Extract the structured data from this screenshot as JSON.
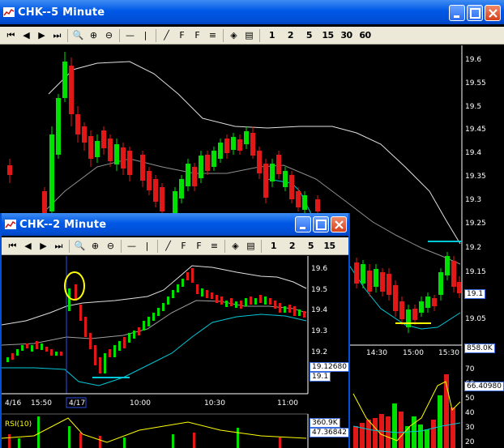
{
  "main_window": {
    "title": "CHK--5 Minute",
    "toolbar": {
      "interval_labels": [
        "1",
        "2",
        "5",
        "15",
        "30",
        "60"
      ]
    },
    "price_axis": [
      "19.6",
      "19.55",
      "19.5",
      "19.45",
      "19.4",
      "19.35",
      "19.3",
      "19.25",
      "19.2",
      "19.15",
      "19.1",
      "19.05"
    ],
    "last_price_tag": "19.1",
    "time_axis": [
      "14:30",
      "15:00",
      "15:30"
    ],
    "volume_tag": "858.0K",
    "rsi_axis": [
      "70",
      "60",
      "50",
      "40",
      "30",
      "20"
    ],
    "rsi_tag": "66.40980"
  },
  "inner_window": {
    "title": "CHK--2 Minute",
    "toolbar": {
      "interval_labels": [
        "1",
        "2",
        "5",
        "15"
      ]
    },
    "price_axis": [
      "19.6",
      "19.5",
      "19.4",
      "19.3",
      "19.2"
    ],
    "price_tag": "19.12680",
    "price_tag_2": "19.1",
    "time_axis": [
      "4/16",
      "15:50",
      "4/17",
      "10:00",
      "10:30",
      "11:00"
    ],
    "rsi_label": "RSI(10)",
    "volume_tag": "360.9K",
    "rsi_tag": "47.36842"
  },
  "colors": {
    "up": "#00e000",
    "down": "#e01818",
    "bollinger": "#e0e0e0",
    "ma": "#a0a0a0",
    "cyan": "#00c8d8",
    "highlight": "#ffff00",
    "titlebar": "#0058e6"
  },
  "icons": {
    "first": "skip-first-icon",
    "prev": "prev-icon",
    "next": "next-icon",
    "last": "skip-last-icon",
    "zoom": "zoom-icon",
    "zoom_in": "zoom-in-icon",
    "zoom_out": "zoom-out-icon"
  }
}
